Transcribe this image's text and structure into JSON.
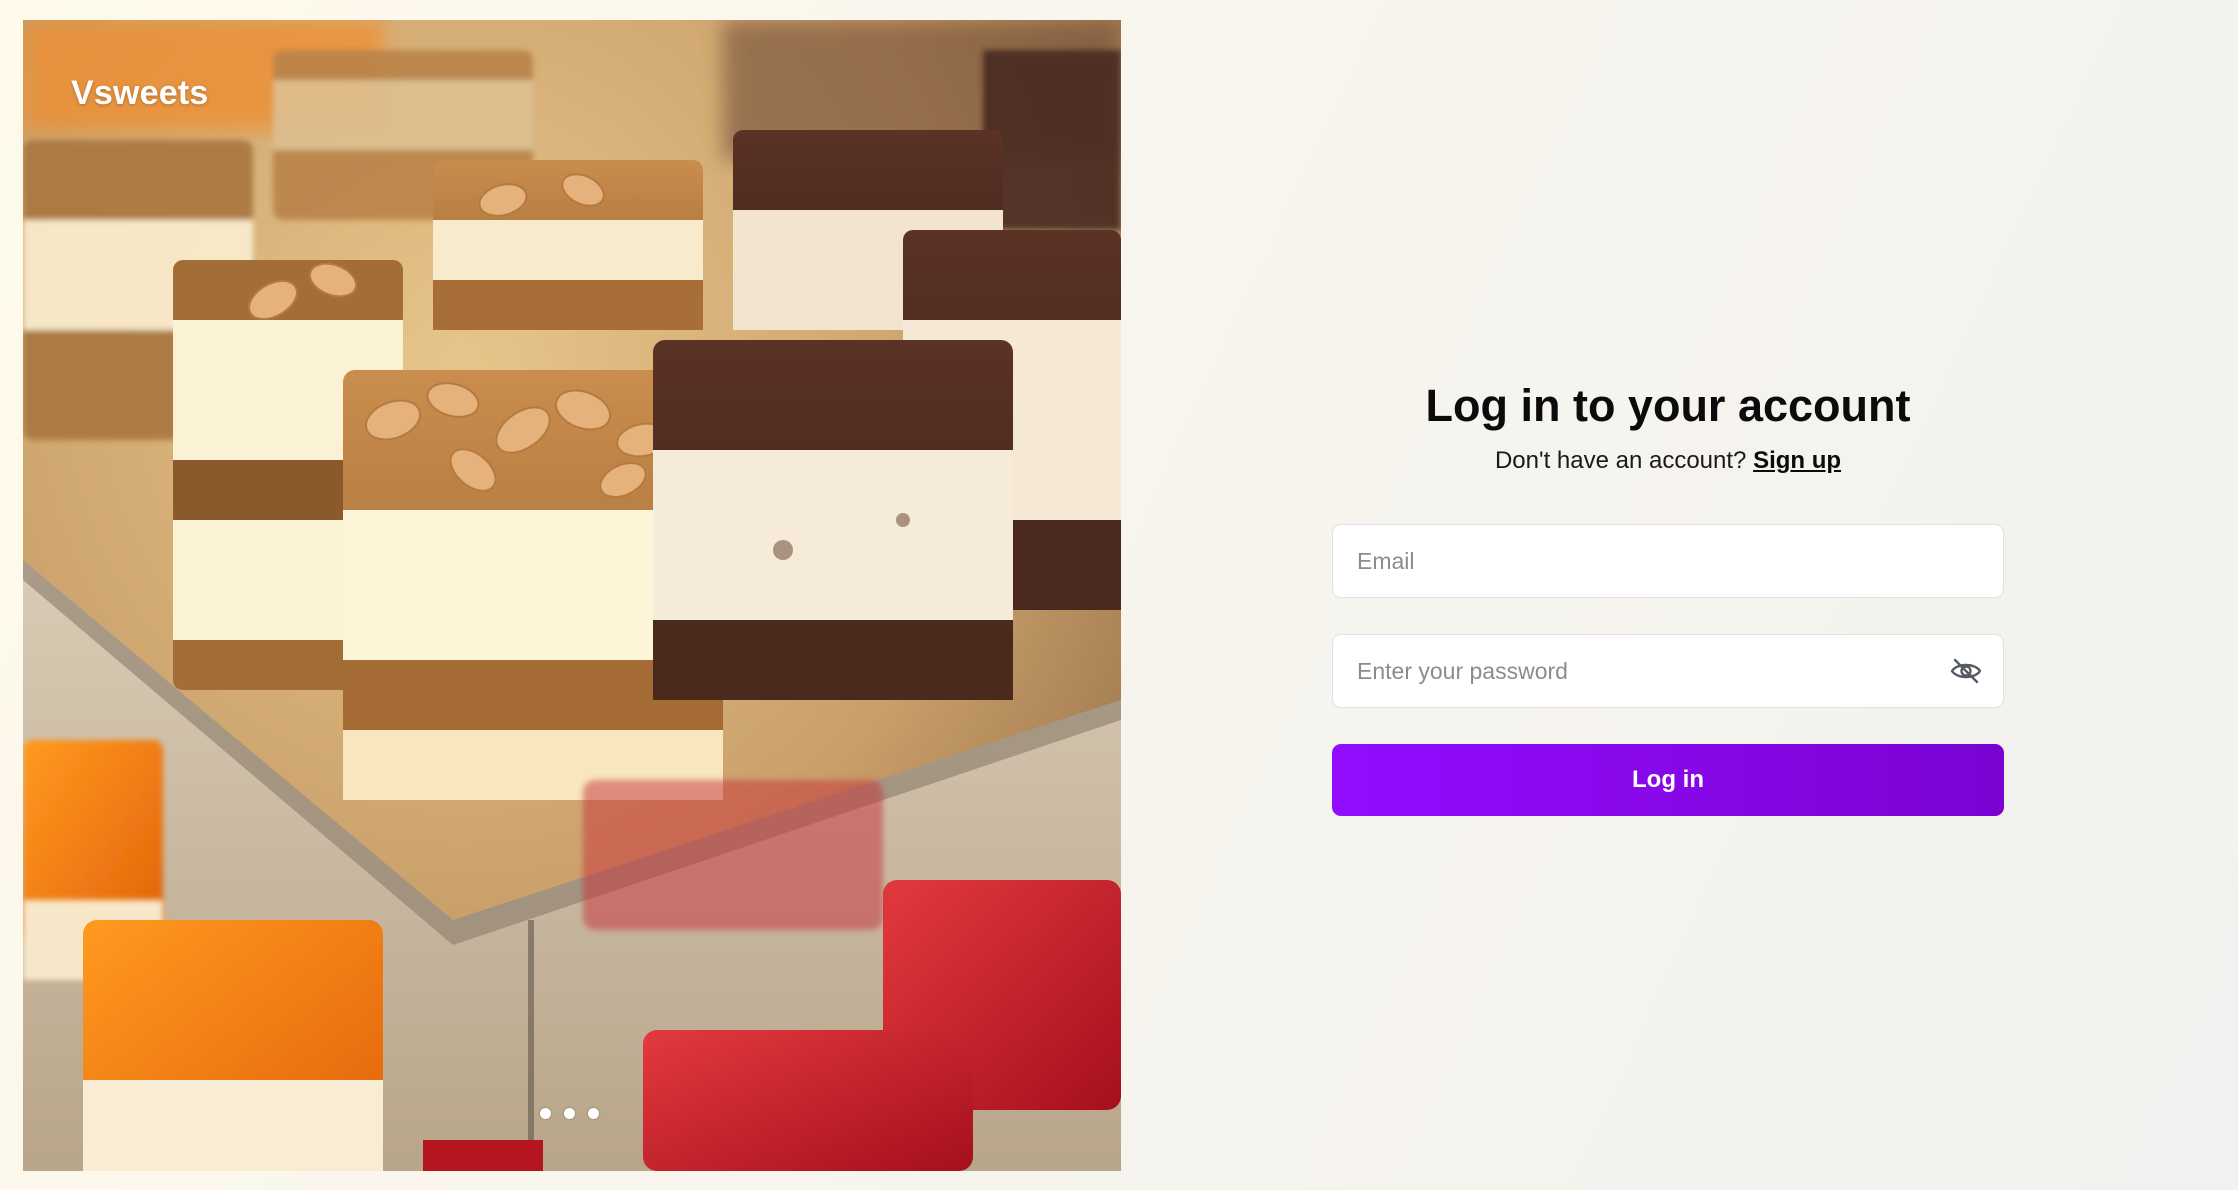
{
  "brand": {
    "name": "Vsweets"
  },
  "carousel": {
    "slide_count": 3,
    "active_index": 0
  },
  "login": {
    "title": "Log in to your account",
    "signup_prompt": "Don't have an account?",
    "signup_link": "Sign up",
    "email_placeholder": "Email",
    "email_value": "",
    "password_placeholder": "Enter your password",
    "password_value": "",
    "password_toggle_icon": "eye-off-icon",
    "submit_label": "Log in"
  },
  "colors": {
    "accent": "#8a05f0",
    "background": "#f8f5ee",
    "title": "#0c0a0b"
  }
}
